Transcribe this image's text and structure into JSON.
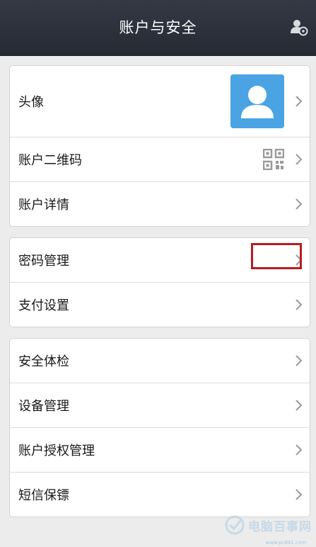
{
  "header": {
    "title": "账户与安全"
  },
  "groups": [
    {
      "items": [
        {
          "label": "头像"
        },
        {
          "label": "账户二维码"
        },
        {
          "label": "账户详情"
        }
      ]
    },
    {
      "items": [
        {
          "label": "密码管理"
        },
        {
          "label": "支付设置"
        }
      ]
    },
    {
      "items": [
        {
          "label": "安全体检"
        },
        {
          "label": "设备管理"
        },
        {
          "label": "账户授权管理"
        },
        {
          "label": "短信保镖"
        }
      ]
    }
  ],
  "watermark": {
    "text": "电脑百事网",
    "url": "www.pc841.com"
  },
  "colors": {
    "header_bg": "#2b2f39",
    "avatar_bg": "#4aa3e3",
    "highlight": "#b81c22"
  }
}
